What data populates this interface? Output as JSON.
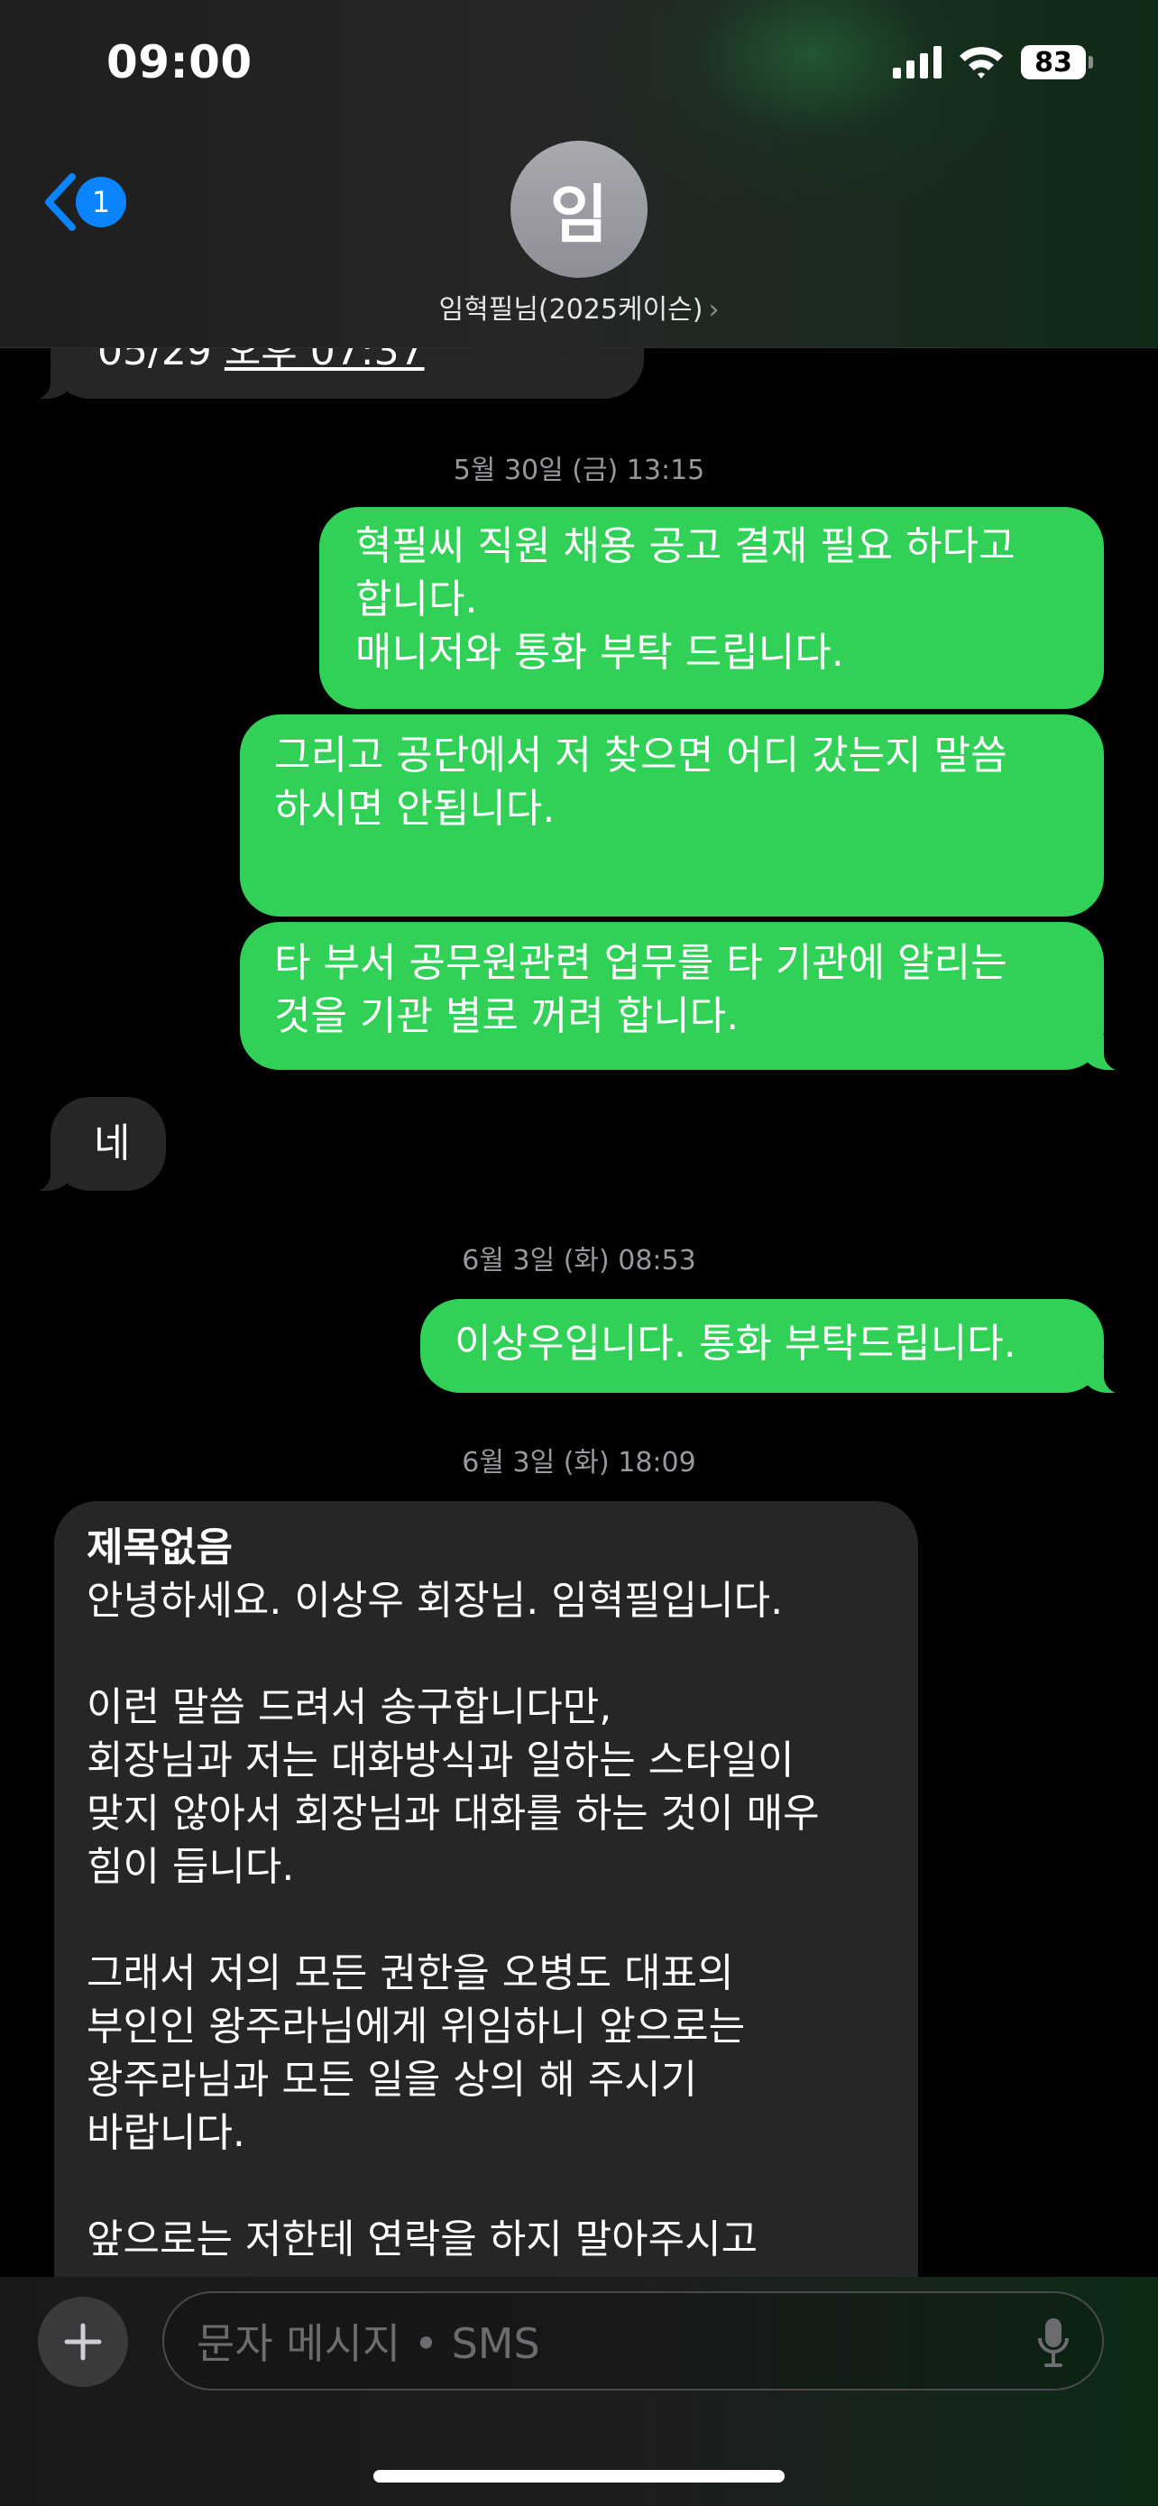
{
  "status_bar": {
    "time": "09:00",
    "battery": "83"
  },
  "header": {
    "back_badge": "1",
    "avatar_initial": "임",
    "contact_name": "임혁필님(2025케이슨)",
    "contact_chevron": "›"
  },
  "conversation": {
    "partial_in": {
      "date": "05/29",
      "time_link": "오후 07:37"
    },
    "timestamp_1": "5월 30일 (금) 13:15",
    "out_1": "혁필씨 직원 채용 공고 결재 필요 하다고\n합니다.\n매니저와 통화 부탁 드립니다.",
    "out_2": "그리고 공단에서 저 찾으면 어디 갔는지 말씀\n하시면 안됩니다.",
    "out_3": "타 부서 공무원관련 업무를 타 기관에 알리는\n것을 기관 별로 꺼려 합니다.",
    "in_1": "네",
    "timestamp_2": "6월 3일 (화) 08:53",
    "out_4": "이상우입니다. 통화 부탁드립니다.",
    "timestamp_3": "6월 3일 (화) 18:09",
    "in_long": {
      "subject": "제목없음",
      "body": "안녕하세요. 이상우 회장님. 임혁필입니다.\n\n이런 말씀 드려서 송구합니다만,\n회장님과 저는 대화방식과 일하는 스타일이\n맞지 않아서 회장님과 대화를 하는 것이 매우\n힘이 듭니다.\n\n그래서 저의 모든 권한을 오병도 대표의\n부인인 왕주라님에게 위임하니 앞으로는\n왕주라님과 모든 일을 상의 해 주시기\n바랍니다.\n\n앞으로는 저한테 연락을 하지 말아주시고"
    }
  },
  "composer": {
    "placeholder": "문자 메시지 • SMS"
  }
}
